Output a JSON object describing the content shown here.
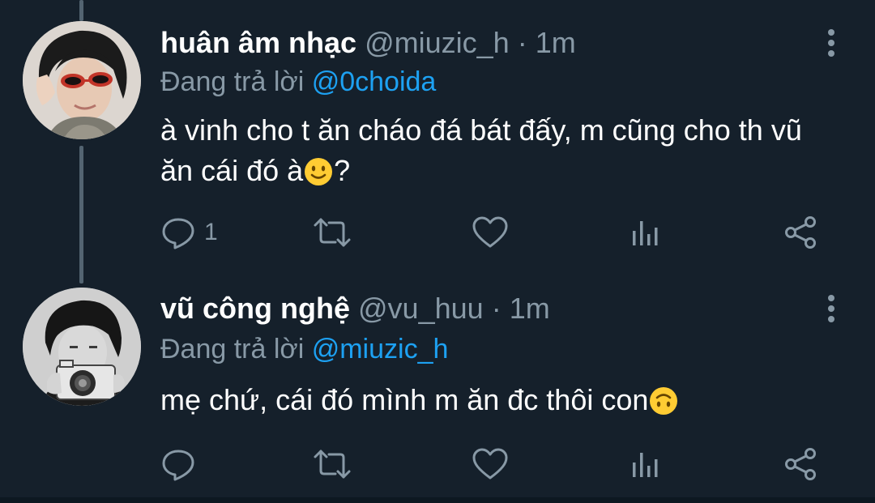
{
  "colors": {
    "background": "#15202b",
    "muted": "#8899a6",
    "link": "#1da1f2",
    "thread_line": "#536471"
  },
  "tweets": [
    {
      "name": "huân âm nhạc",
      "handle": "@miuzic_h",
      "separator": "·",
      "time": "1m",
      "reply_label": "Đang trả lời",
      "reply_to": "@0choida",
      "text_before_emoji": "à vinh cho t ăn cháo đá bát đấy, m cũng cho th vũ ăn cái đó à",
      "emoji": "slightly-smiling-face-icon",
      "text_after_emoji": "?",
      "reply_count": "1"
    },
    {
      "name": "vũ công nghệ",
      "handle": "@vu_huu",
      "separator": "·",
      "time": "1m",
      "reply_label": "Đang trả lời",
      "reply_to": "@miuzic_h",
      "text_before_emoji": "mẹ chứ, cái đó mình m ăn đc thôi con",
      "emoji": "upside-down-face-icon",
      "text_after_emoji": "",
      "reply_count": ""
    }
  ]
}
